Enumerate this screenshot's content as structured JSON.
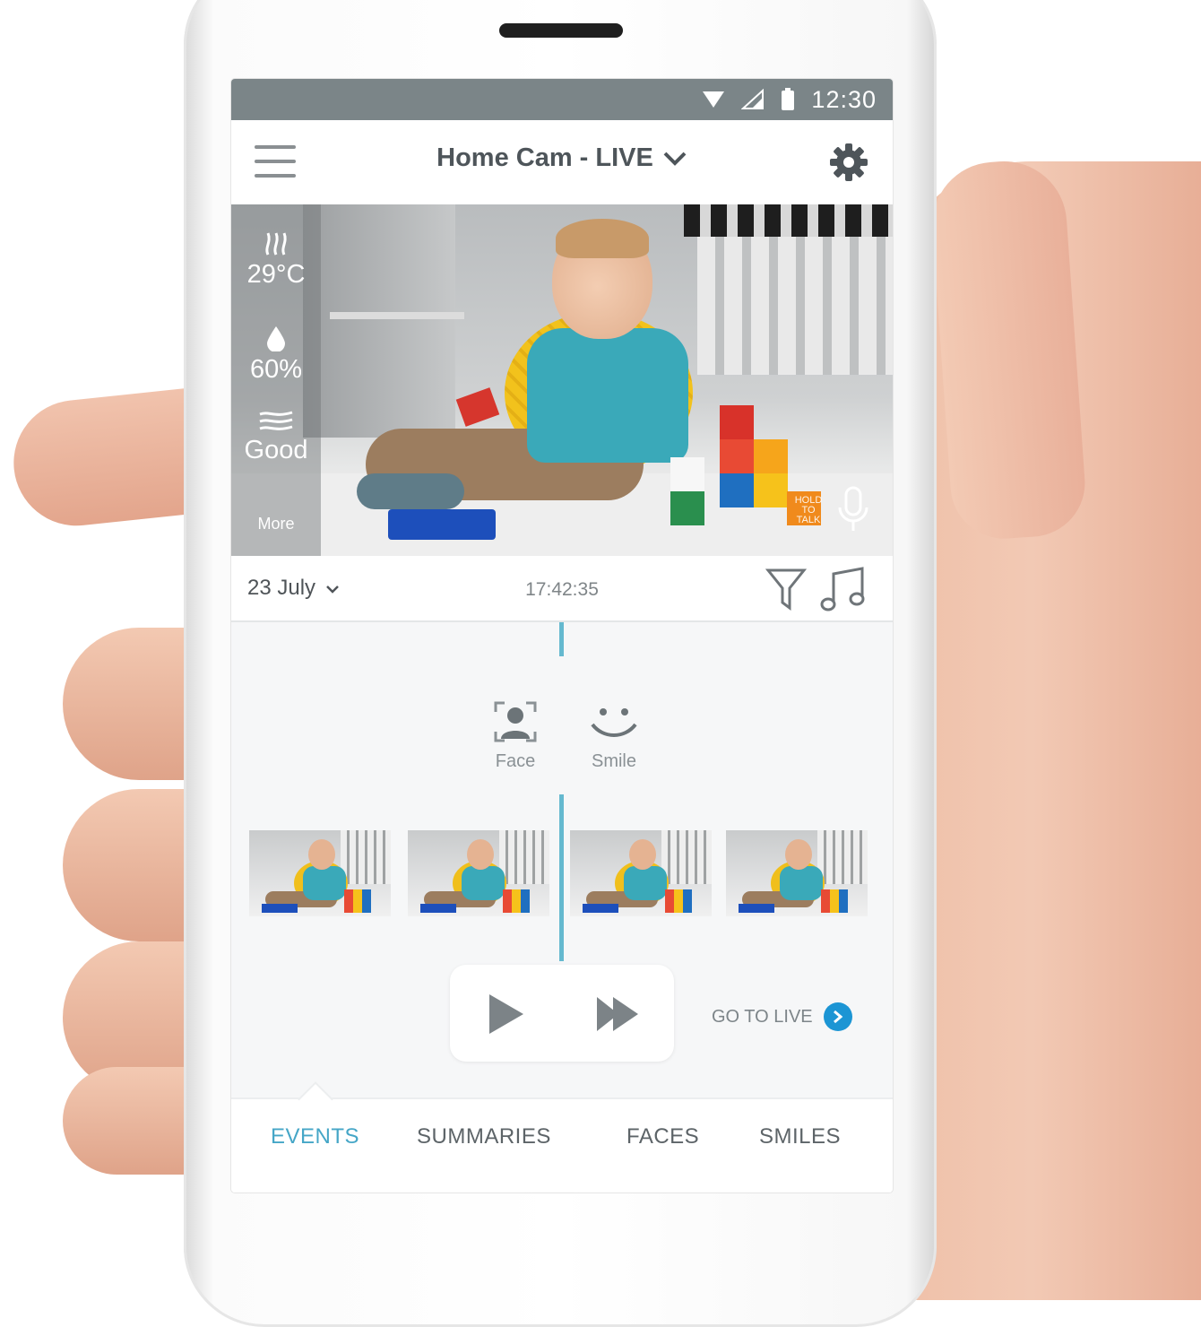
{
  "status_bar": {
    "time": "12:30"
  },
  "header": {
    "camera_title": "Home Cam - LIVE"
  },
  "sensors": {
    "temperature": "29°C",
    "humidity": "60%",
    "air_quality": "Good",
    "more_label": "More"
  },
  "talk": {
    "label_line1": "HOLD",
    "label_line2": "TO",
    "label_line3": "TALK"
  },
  "timeline": {
    "date": "23 July",
    "time": "17:42:35",
    "tags": [
      {
        "label": "Face",
        "icon": "face-recognition-icon"
      },
      {
        "label": "Smile",
        "icon": "smile-icon"
      }
    ],
    "go_to_live": "GO TO LIVE"
  },
  "tabs": [
    {
      "label": "EVENTS",
      "active": true
    },
    {
      "label": "SUMMARIES",
      "active": false
    },
    {
      "label": "FACES",
      "active": false
    },
    {
      "label": "SMILES",
      "active": false
    }
  ],
  "colors": {
    "accent": "#45a6c7",
    "status_bar": "#7b8588",
    "go_live": "#1c95d4"
  }
}
